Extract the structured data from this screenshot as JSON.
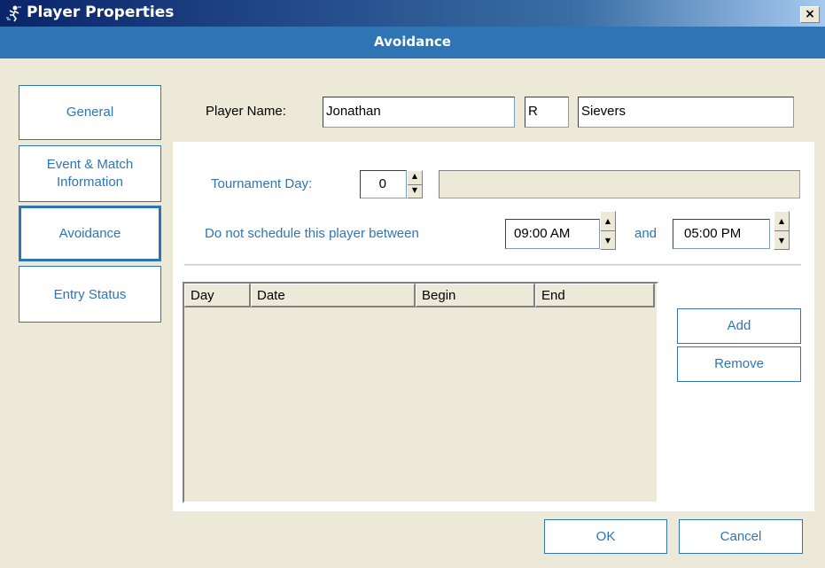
{
  "window": {
    "title": "Player Properties",
    "icon": "player-properties-icon",
    "close_label": "×"
  },
  "header": {
    "title": "Avoidance"
  },
  "sidebar": {
    "items": [
      {
        "label": "General"
      },
      {
        "label_line1": "Event & Match",
        "label_line2": "Information"
      },
      {
        "label": "Avoidance",
        "active": true
      },
      {
        "label": "Entry Status"
      }
    ]
  },
  "player": {
    "label": "Player Name:",
    "first": "Jonathan",
    "middle": "R",
    "last": "Sievers"
  },
  "tournament_day": {
    "label": "Tournament Day:",
    "value": "0",
    "description": ""
  },
  "avoid": {
    "label": "Do not schedule this player between",
    "start": "09:00 AM",
    "and_label": "and",
    "end": "05:00 PM"
  },
  "table": {
    "columns": [
      "Day",
      "Date",
      "Begin",
      "End"
    ],
    "rows": []
  },
  "actions": {
    "add": "Add",
    "remove": "Remove"
  },
  "footer": {
    "ok": "OK",
    "cancel": "Cancel"
  },
  "colors": {
    "accent": "#2f75b4",
    "titlebar": "#0a246a",
    "dialog_bg": "#ece9d8"
  }
}
